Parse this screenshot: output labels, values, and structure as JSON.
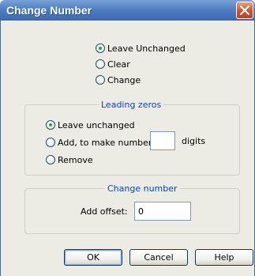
{
  "window": {
    "title": "Change Number"
  },
  "action": {
    "options": [
      {
        "label": "Leave Unchanged",
        "checked": true
      },
      {
        "label": "Clear",
        "checked": false
      },
      {
        "label": "Change",
        "checked": false
      }
    ]
  },
  "leading_zeros": {
    "title": "Leading zeros",
    "options": [
      {
        "label": "Leave unchanged",
        "checked": true
      },
      {
        "label": "Add, to make number with:",
        "checked": false
      },
      {
        "label": "Remove",
        "checked": false
      }
    ],
    "digits_value": "",
    "digits_label": "digits"
  },
  "change_number": {
    "title": "Change number",
    "offset_label": "Add offset:",
    "offset_value": "0"
  },
  "buttons": {
    "ok": "OK",
    "cancel": "Cancel",
    "help": "Help"
  },
  "colors": {
    "titlebar": "#3b6ab4",
    "group_title": "#0046d5",
    "dialog_bg": "#ecebe4",
    "radio_dot": "#2fa32f"
  }
}
